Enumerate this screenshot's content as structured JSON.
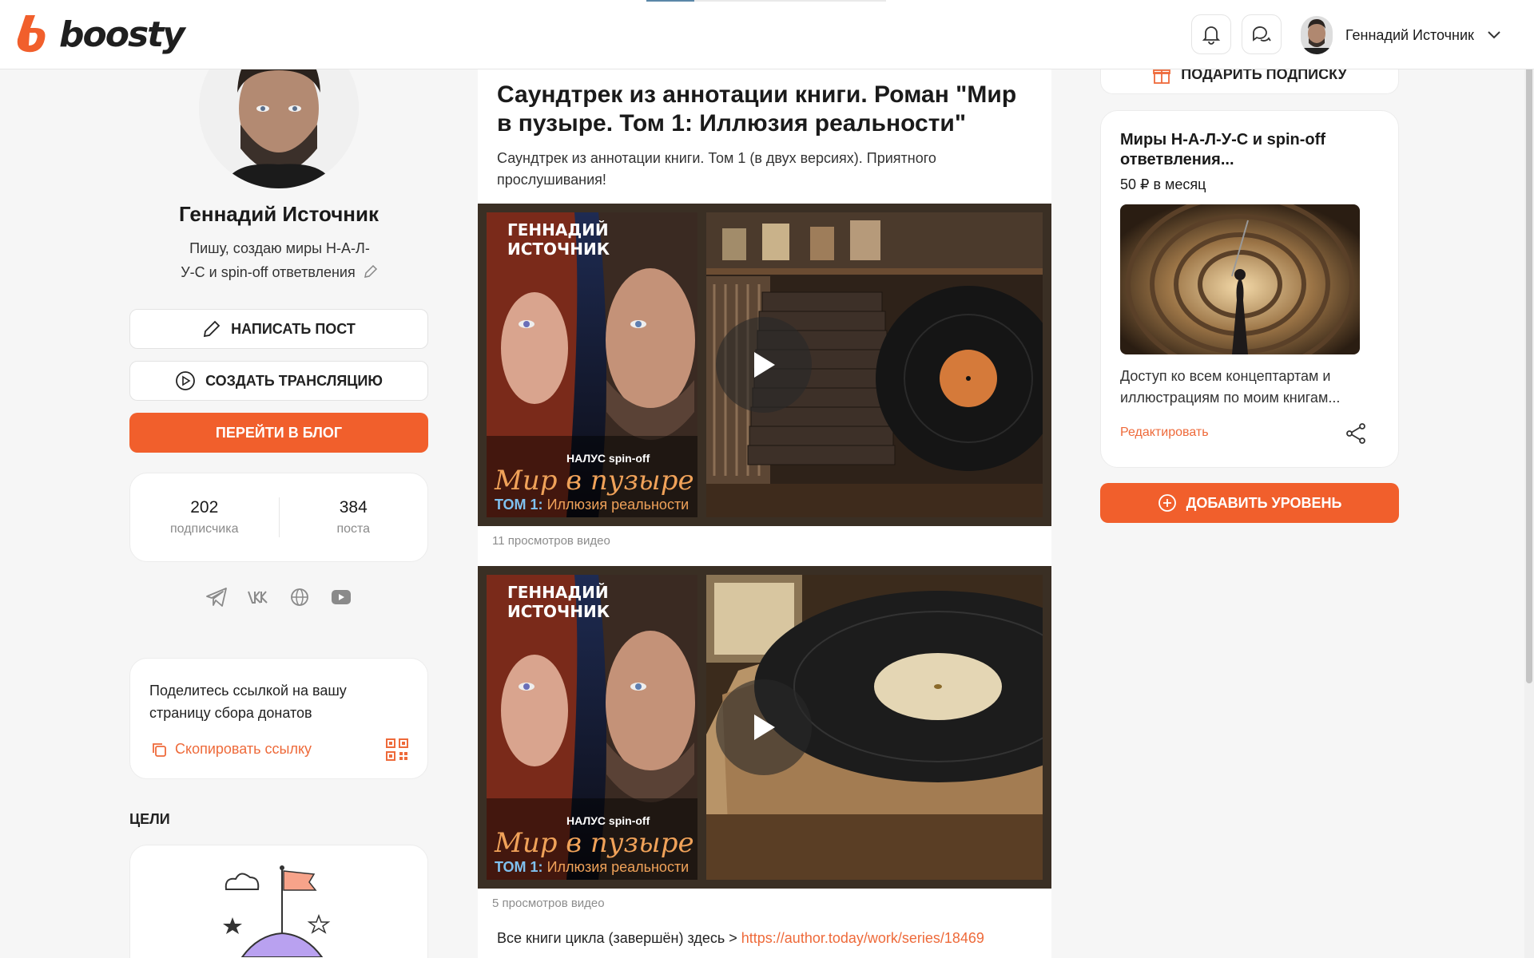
{
  "header": {
    "logo_text": "boosty",
    "user_name": "Геннадий Источник",
    "icons": [
      "bell-icon",
      "chat-icon",
      "chevron-down-icon"
    ]
  },
  "profile": {
    "name": "Геннадий Источник",
    "bio_line1": "Пишу, создаю миры Н-А-Л-",
    "bio_line2": "У-С и spin-off ответвления",
    "write_post": "НАПИСАТЬ ПОСТ",
    "create_stream": "СОЗДАТЬ ТРАНСЛЯЦИЮ",
    "go_to_blog": "ПЕРЕЙТИ В БЛОГ",
    "subscribers_count": "202",
    "subscribers_label": "подписчика",
    "posts_count": "384",
    "posts_label": "поста",
    "socials": [
      "telegram-icon",
      "vk-icon",
      "globe-icon",
      "youtube-icon"
    ]
  },
  "share": {
    "text_line1": "Поделитесь ссылкой на вашу",
    "text_line2": "страницу сбора донатов",
    "copy_link": "Скопировать ссылку"
  },
  "goals": {
    "title": "ЦЕЛИ"
  },
  "post": {
    "title_line1": "Саундтрек из аннотации книги. Роман \"Мир",
    "title_line2": "в пузыре. Том 1: Иллюзия реальности\"",
    "desc_line1": "Саундтрек из аннотации книги. Том 1 (в двух версиях). Приятного",
    "desc_line2": "прослушивания!",
    "videos": [
      {
        "views": "11 просмотров видео"
      },
      {
        "views": "5 просмотров видео"
      }
    ],
    "cover": {
      "author": "ГЕННАДИЙ ИСТОЧНИК",
      "series": "НАЛУС spin-off",
      "title": "Мир в пузыре",
      "vol_prefix": "ТОМ 1:",
      "vol_name": "Иллюзия реальности"
    },
    "footer_text": "Все книги цикла (завершён) здесь > ",
    "footer_link": "https://author.today/work/series/18469"
  },
  "sidebar": {
    "gift": "ПОДАРИТЬ ПОДПИСКУ",
    "tier_title_line1": "Миры Н-А-Л-У-С и spin-off",
    "tier_title_line2": "ответвления...",
    "tier_price": "50 ₽ в месяц",
    "tier_desc_line1": "Доступ ко всем концептартам и",
    "tier_desc_line2": "иллюстрациям по моим книгам...",
    "tier_edit": "Редактировать",
    "add_level": "ДОБАВИТЬ УРОВЕНЬ"
  },
  "colors": {
    "accent": "#f15f2c",
    "link": "#ee6a3a"
  }
}
